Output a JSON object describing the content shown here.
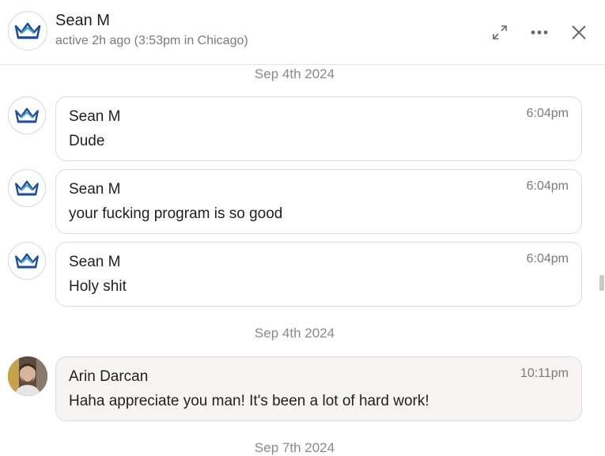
{
  "header": {
    "name": "Sean M",
    "status": "active 2h ago (3:53pm in Chicago)",
    "icons": [
      "expand-icon",
      "more-icon",
      "close-icon"
    ]
  },
  "colors": {
    "crown_dark": "#1f4f9c",
    "crown_light": "#3fa3db",
    "border": "#dcdcdc",
    "mine_bubble": "#f6f5f3"
  },
  "messages": [
    {
      "date": "Sep 4th 2024"
    },
    {
      "sender": "Sean M",
      "time": "6:04pm",
      "text": "Dude"
    },
    {
      "sender": "Sean M",
      "time": "6:04pm",
      "text": "your fucking program is so good"
    },
    {
      "sender": "Sean M",
      "time": "6:04pm",
      "text": "Holy shit"
    },
    {
      "date": "Sep 4th 2024"
    },
    {
      "sender": "Arin Darcan",
      "time": "10:11pm",
      "text": "Haha appreciate you man! It's been a lot of hard work!"
    },
    {
      "date": "Sep 7th 2024"
    }
  ]
}
